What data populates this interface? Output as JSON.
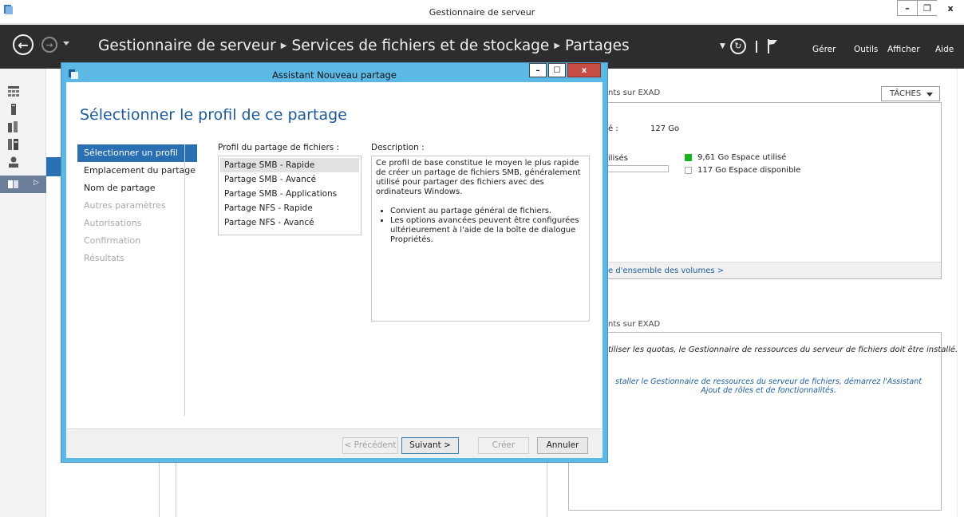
{
  "window": {
    "title": "Gestionnaire de serveur",
    "btn_minimize": "–",
    "btn_maximize": "❐",
    "btn_close": "x"
  },
  "ribbon": {
    "back": "←",
    "forward": "→",
    "breadcrumb": [
      "Gestionnaire de serveur",
      "Services de fichiers et de stockage",
      "Partages"
    ],
    "breadcrumb_sep": "▶",
    "refresh": "↻",
    "menus": [
      "Gérer",
      "Outils",
      "Afficher",
      "Aide"
    ]
  },
  "right_panel": {
    "volume_title": "nts sur EXAD",
    "tasks_label": "TÂCHES",
    "capacity_label": "é :",
    "capacity_value": "127 Go",
    "used_label": "ilisés",
    "used_legend": "9,61 Go Espace utilisé",
    "free_legend": "117 Go Espace disponible",
    "volumes_link": "e d'ensemble des volumes >",
    "quota_title": "nts sur EXAD",
    "quota_message": "tiliser les quotas, le Gestionnaire de ressources du serveur de fichiers doit être installé.",
    "install_link": "staller le Gestionnaire de ressources du serveur de fichiers, démarrez l'Assistant Ajout de rôles et de fonctionnalités.",
    "colors": {
      "used": "#1bb31b",
      "free": "#ffffff"
    }
  },
  "dialog": {
    "title": "Assistant Nouveau partage",
    "btn_minimize": "–",
    "btn_maximize": "☐",
    "btn_close": "x",
    "heading": "Sélectionner le profil de ce partage",
    "steps": [
      {
        "label": "Sélectionner un profil",
        "state": "selected"
      },
      {
        "label": "Emplacement du partage",
        "state": "enabled"
      },
      {
        "label": "Nom de partage",
        "state": "enabled"
      },
      {
        "label": "Autres paramètres",
        "state": "disabled"
      },
      {
        "label": "Autorisations",
        "state": "disabled"
      },
      {
        "label": "Confirmation",
        "state": "disabled"
      },
      {
        "label": "Résultats",
        "state": "disabled"
      }
    ],
    "profile_label": "Profil du partage de fichiers :",
    "profiles": [
      "Partage SMB - Rapide",
      "Partage SMB - Avancé",
      "Partage SMB - Applications",
      "Partage NFS - Rapide",
      "Partage NFS - Avancé"
    ],
    "selected_profile_index": 0,
    "description_label": "Description :",
    "description_text": "Ce profil de base constitue le moyen le plus rapide de créer un partage de fichiers SMB, généralement utilisé pour partager des fichiers avec des ordinateurs Windows.",
    "description_bullets": [
      "Convient au partage général de fichiers.",
      "Les options avancées peuvent être configurées ultérieurement à l'aide de la boîte de dialogue Propriétés."
    ],
    "buttons": {
      "previous": "< Précédent",
      "next": "Suivant >",
      "create": "Créer",
      "cancel": "Annuler"
    },
    "colors": {
      "frame": "#5cb9e6",
      "heading": "#1f5a96",
      "selected_step": "#2a6fb2"
    }
  }
}
